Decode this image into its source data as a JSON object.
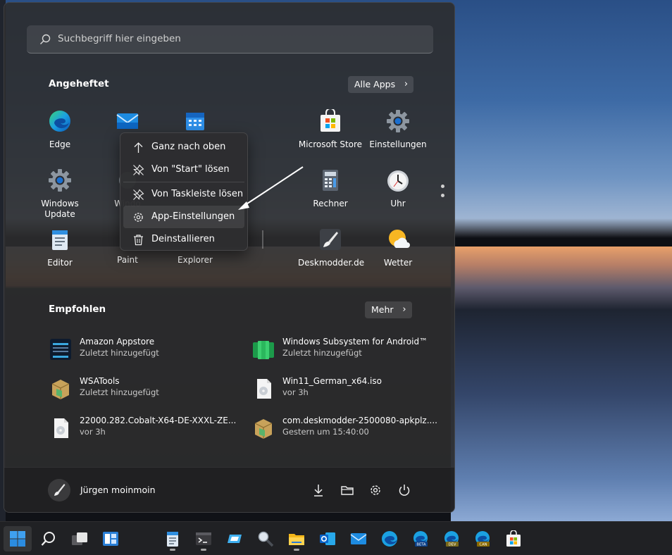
{
  "search": {
    "placeholder": "Suchbegriff hier eingeben"
  },
  "pinned": {
    "title": "Angeheftet",
    "all_apps": "Alle Apps",
    "apps": [
      {
        "label": "Edge",
        "icon": "edge-icon"
      },
      {
        "label": "",
        "icon": "mail-icon"
      },
      {
        "label": "",
        "icon": "calendar-icon"
      },
      {
        "label": "Microsoft Store",
        "icon": "store-icon"
      },
      {
        "label": "Einstellungen",
        "icon": "settings-gear-icon"
      },
      {
        "label": "Windows\nUpdate",
        "icon": "windows-update-icon"
      },
      {
        "label": "Windo",
        "icon": "windows-tools-icon"
      },
      {
        "label": "Rechner",
        "icon": "calculator-icon"
      },
      {
        "label": "Uhr",
        "icon": "clock-icon"
      },
      {
        "label": "Editor",
        "icon": "notepad-icon"
      },
      {
        "label": "Paint",
        "icon": "paint-icon"
      },
      {
        "label": "Explorer",
        "icon": "explorer-icon"
      },
      {
        "label": "Deskmodder.de",
        "icon": "brush-icon"
      },
      {
        "label": "Wetter",
        "icon": "weather-icon"
      }
    ]
  },
  "context_menu": {
    "items": [
      {
        "label": "Ganz nach oben",
        "icon": "arrow-up-icon"
      },
      {
        "label": "Von \"Start\" lösen",
        "icon": "unpin-icon"
      },
      {
        "label": "Von Taskleiste lösen",
        "icon": "unpin-taskbar-icon"
      },
      {
        "label": "App-Einstellungen",
        "icon": "gear-icon"
      },
      {
        "label": "Deinstallieren",
        "icon": "trash-icon"
      }
    ]
  },
  "recommended": {
    "title": "Empfohlen",
    "more": "Mehr",
    "items": [
      {
        "title": "Amazon Appstore",
        "subtitle": "Zuletzt hinzugefügt",
        "icon": "amazon-appstore-icon"
      },
      {
        "title": "Windows Subsystem for Android™",
        "subtitle": "Zuletzt hinzugefügt",
        "icon": "wsa-icon"
      },
      {
        "title": "WSATools",
        "subtitle": "Zuletzt hinzugefügt",
        "icon": "package-icon"
      },
      {
        "title": "Win11_German_x64.iso",
        "subtitle": "vor 3h",
        "icon": "iso-file-icon"
      },
      {
        "title": "22000.282.Cobalt-X64-DE-XXXL-ZE...",
        "subtitle": "vor 3h",
        "icon": "iso-file-icon"
      },
      {
        "title": "com.deskmodder-2500080-apkplz....",
        "subtitle": "Gestern um 15:40:00",
        "icon": "package-icon"
      }
    ]
  },
  "user": {
    "name": "Jürgen moinmoin"
  },
  "footer_icons": [
    "download-icon",
    "folder-icon",
    "settings-icon",
    "power-icon"
  ],
  "taskbar": {
    "items": [
      "start-icon",
      "search-icon",
      "task-view-icon",
      "widgets-icon",
      "notepad-icon",
      "terminal-icon",
      "wsa-icon",
      "magnifier-icon",
      "file-explorer-icon",
      "outlook-icon",
      "mail-icon",
      "edge-icon",
      "edge-beta-icon",
      "edge-dev-icon",
      "edge-canary-icon",
      "store-icon"
    ],
    "badges": {
      "beta": "BETA",
      "dev": "DEV",
      "canary": "CAN"
    }
  }
}
